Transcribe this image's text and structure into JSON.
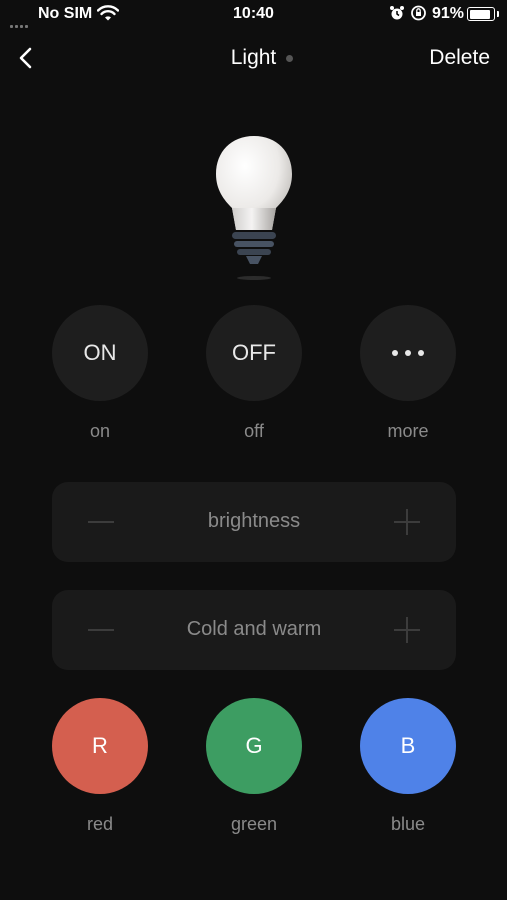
{
  "status_bar": {
    "carrier": "No SIM",
    "time": "10:40",
    "battery_percent": "91%",
    "battery_level": 0.91,
    "icons": [
      "signal-dots-icon",
      "wifi-icon",
      "alarm-icon",
      "orientation-lock-icon",
      "battery-icon"
    ]
  },
  "nav": {
    "back_icon": "chevron-left-icon",
    "title": "Light",
    "delete_label": "Delete"
  },
  "device_icon": "light-bulb-icon",
  "power_controls": [
    {
      "button": "ON",
      "label": "on"
    },
    {
      "button": "OFF",
      "label": "off"
    },
    {
      "button": "more-dots-icon",
      "label": "more"
    }
  ],
  "adjusters": {
    "brightness": "brightness",
    "color_temperature": "Cold and warm",
    "decrease_icon": "minus-icon",
    "increase_icon": "plus-icon"
  },
  "color_controls": [
    {
      "letter": "R",
      "label": "red",
      "color": "#d45f4f"
    },
    {
      "letter": "G",
      "label": "green",
      "color": "#3d9d62"
    },
    {
      "letter": "B",
      "label": "blue",
      "color": "#4f82e8"
    }
  ],
  "colors": {
    "background": "#0e0e0e",
    "button_bg": "#1e1e1e",
    "panel_bg": "#1a1a1a",
    "muted_text": "#8a8a8a"
  }
}
